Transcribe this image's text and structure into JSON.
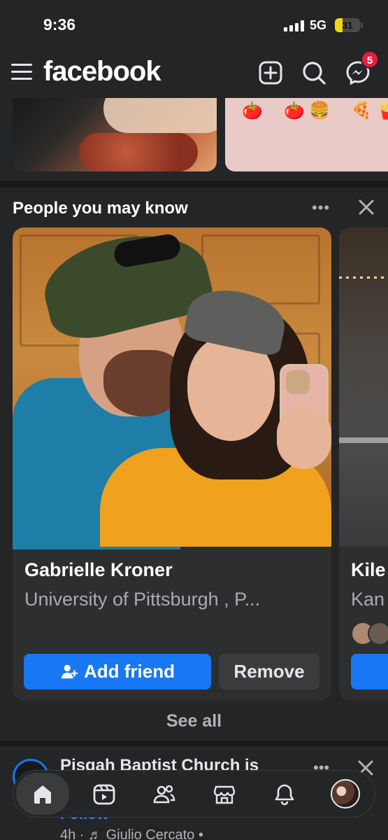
{
  "status_bar": {
    "time": "9:36",
    "network": "5G",
    "battery": "31",
    "battery_level": 0.31
  },
  "header": {
    "logo": "facebook",
    "messenger_badge": "5"
  },
  "top_photos": {
    "emojis": [
      "🍅",
      "🍅",
      "🍔",
      "🍕",
      "🍟"
    ]
  },
  "pymk": {
    "title": "People you may know",
    "more_label": "•••",
    "see_all": "See all",
    "cards": [
      {
        "name": "Gabrielle Kroner",
        "subtitle": "University of Pittsburgh , P...",
        "add_label": "Add friend",
        "remove_label": "Remove"
      },
      {
        "name": "Kile",
        "subtitle": "Kan"
      }
    ]
  },
  "post": {
    "name": "Pisgah Baptist Church is",
    "follow": "Follow",
    "meta": "4h · ♬ Giulio Cercato •",
    "more_label": "•••"
  },
  "nav": {
    "items": [
      "home",
      "video",
      "friends",
      "marketplace",
      "notifications",
      "profile"
    ],
    "active": "home"
  },
  "colors": {
    "accent": "#1877f2",
    "badge": "#e41e3f",
    "background": "#18191a",
    "surface": "#242526"
  }
}
